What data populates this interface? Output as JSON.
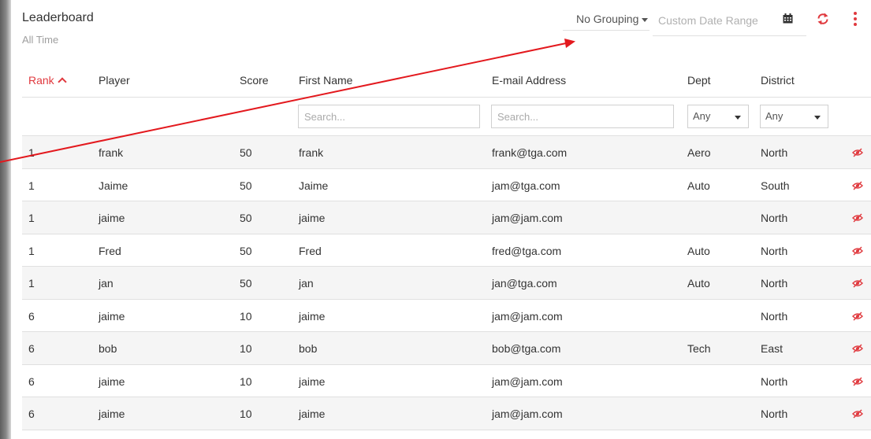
{
  "header": {
    "title": "Leaderboard",
    "subtitle": "All Time"
  },
  "toolbar": {
    "grouping_label": "No Grouping",
    "date_range_placeholder": "Custom Date Range",
    "icons": [
      "calendar-icon",
      "refresh-icon",
      "more-vert-icon"
    ]
  },
  "colors": {
    "accent": "#e0393e",
    "stripe": "#f5f5f5",
    "border": "#e0e0e0"
  },
  "table": {
    "columns": {
      "rank": "Rank",
      "player": "Player",
      "score": "Score",
      "first_name": "First Name",
      "email": "E-mail Address",
      "dept": "Dept",
      "district": "District"
    },
    "filters": {
      "first_name_placeholder": "Search...",
      "email_placeholder": "Search...",
      "dept_value": "Any",
      "district_value": "Any"
    },
    "rows": [
      {
        "rank": "1",
        "player": "frank",
        "score": "50",
        "first_name": "frank",
        "email": "frank@tga.com",
        "dept": "Aero",
        "district": "North"
      },
      {
        "rank": "1",
        "player": "Jaime",
        "score": "50",
        "first_name": "Jaime",
        "email": "jam@tga.com",
        "dept": "Auto",
        "district": "South"
      },
      {
        "rank": "1",
        "player": "jaime",
        "score": "50",
        "first_name": "jaime",
        "email": "jam@jam.com",
        "dept": "",
        "district": "North"
      },
      {
        "rank": "1",
        "player": "Fred",
        "score": "50",
        "first_name": "Fred",
        "email": "fred@tga.com",
        "dept": "Auto",
        "district": "North"
      },
      {
        "rank": "1",
        "player": "jan",
        "score": "50",
        "first_name": "jan",
        "email": "jan@tga.com",
        "dept": "Auto",
        "district": "North"
      },
      {
        "rank": "6",
        "player": "jaime",
        "score": "10",
        "first_name": "jaime",
        "email": "jam@jam.com",
        "dept": "",
        "district": "North"
      },
      {
        "rank": "6",
        "player": "bob",
        "score": "10",
        "first_name": "bob",
        "email": "bob@tga.com",
        "dept": "Tech",
        "district": "East"
      },
      {
        "rank": "6",
        "player": "jaime",
        "score": "10",
        "first_name": "jaime",
        "email": "jam@jam.com",
        "dept": "",
        "district": "North"
      },
      {
        "rank": "6",
        "player": "jaime",
        "score": "10",
        "first_name": "jaime",
        "email": "jam@jam.com",
        "dept": "",
        "district": "North"
      }
    ]
  }
}
